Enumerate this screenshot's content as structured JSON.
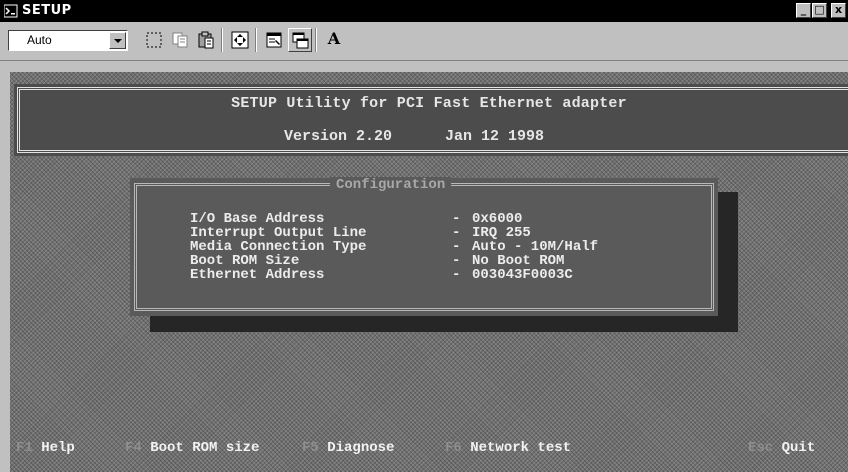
{
  "window": {
    "title": "SETUP",
    "controls": {
      "minimize": "_",
      "restore": "□",
      "close": "x"
    }
  },
  "toolbar": {
    "font_select_value": "Auto",
    "buttons": [
      "mark-icon",
      "copy-icon",
      "paste-icon",
      "fullscreen-icon",
      "properties-icon",
      "background-icon"
    ],
    "font_button_label": "A"
  },
  "screen": {
    "header": {
      "line1": "SETUP Utility for PCI Fast Ethernet adapter",
      "version": "Version 2.20",
      "date": "Jan 12 1998"
    },
    "config": {
      "title": "Configuration",
      "rows": [
        {
          "label": "I/O Base Address",
          "dash": "-",
          "value": "0x6000"
        },
        {
          "label": "Interrupt Output Line",
          "dash": "-",
          "value": "IRQ 255"
        },
        {
          "label": "Media Connection Type",
          "dash": "-",
          "value": "Auto -  10M/Half"
        },
        {
          "label": "Boot ROM Size",
          "dash": "-",
          "value": "No Boot ROM"
        },
        {
          "label": "Ethernet Address",
          "dash": "-",
          "value": "003043F0003C"
        }
      ]
    },
    "function_keys": [
      {
        "key": "F1",
        "action": "Help"
      },
      {
        "key": "F4",
        "action": "Boot ROM size"
      },
      {
        "key": "F5",
        "action": "Diagnose"
      },
      {
        "key": "F6",
        "action": "Network test"
      },
      {
        "key": "Esc",
        "action": "Quit"
      }
    ]
  },
  "colors": {
    "titlebar": "#000000",
    "window_face": "#c0c0c0",
    "dos_text": "#e6e6e6",
    "dos_key_text": "#8e8e8e"
  }
}
